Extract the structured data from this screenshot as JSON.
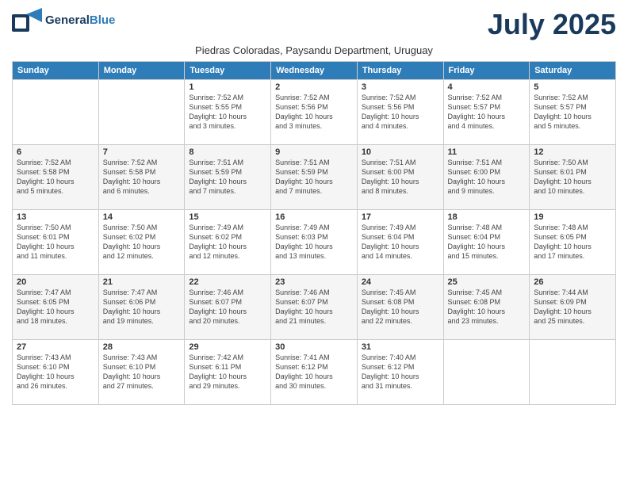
{
  "header": {
    "logo_general": "General",
    "logo_blue": "Blue",
    "month_title": "July 2025",
    "subtitle": "Piedras Coloradas, Paysandu Department, Uruguay"
  },
  "weekdays": [
    "Sunday",
    "Monday",
    "Tuesday",
    "Wednesday",
    "Thursday",
    "Friday",
    "Saturday"
  ],
  "rows": [
    [
      {
        "day": "",
        "info": ""
      },
      {
        "day": "",
        "info": ""
      },
      {
        "day": "1",
        "info": "Sunrise: 7:52 AM\nSunset: 5:55 PM\nDaylight: 10 hours\nand 3 minutes."
      },
      {
        "day": "2",
        "info": "Sunrise: 7:52 AM\nSunset: 5:56 PM\nDaylight: 10 hours\nand 3 minutes."
      },
      {
        "day": "3",
        "info": "Sunrise: 7:52 AM\nSunset: 5:56 PM\nDaylight: 10 hours\nand 4 minutes."
      },
      {
        "day": "4",
        "info": "Sunrise: 7:52 AM\nSunset: 5:57 PM\nDaylight: 10 hours\nand 4 minutes."
      },
      {
        "day": "5",
        "info": "Sunrise: 7:52 AM\nSunset: 5:57 PM\nDaylight: 10 hours\nand 5 minutes."
      }
    ],
    [
      {
        "day": "6",
        "info": "Sunrise: 7:52 AM\nSunset: 5:58 PM\nDaylight: 10 hours\nand 5 minutes."
      },
      {
        "day": "7",
        "info": "Sunrise: 7:52 AM\nSunset: 5:58 PM\nDaylight: 10 hours\nand 6 minutes."
      },
      {
        "day": "8",
        "info": "Sunrise: 7:51 AM\nSunset: 5:59 PM\nDaylight: 10 hours\nand 7 minutes."
      },
      {
        "day": "9",
        "info": "Sunrise: 7:51 AM\nSunset: 5:59 PM\nDaylight: 10 hours\nand 7 minutes."
      },
      {
        "day": "10",
        "info": "Sunrise: 7:51 AM\nSunset: 6:00 PM\nDaylight: 10 hours\nand 8 minutes."
      },
      {
        "day": "11",
        "info": "Sunrise: 7:51 AM\nSunset: 6:00 PM\nDaylight: 10 hours\nand 9 minutes."
      },
      {
        "day": "12",
        "info": "Sunrise: 7:50 AM\nSunset: 6:01 PM\nDaylight: 10 hours\nand 10 minutes."
      }
    ],
    [
      {
        "day": "13",
        "info": "Sunrise: 7:50 AM\nSunset: 6:01 PM\nDaylight: 10 hours\nand 11 minutes."
      },
      {
        "day": "14",
        "info": "Sunrise: 7:50 AM\nSunset: 6:02 PM\nDaylight: 10 hours\nand 12 minutes."
      },
      {
        "day": "15",
        "info": "Sunrise: 7:49 AM\nSunset: 6:02 PM\nDaylight: 10 hours\nand 12 minutes."
      },
      {
        "day": "16",
        "info": "Sunrise: 7:49 AM\nSunset: 6:03 PM\nDaylight: 10 hours\nand 13 minutes."
      },
      {
        "day": "17",
        "info": "Sunrise: 7:49 AM\nSunset: 6:04 PM\nDaylight: 10 hours\nand 14 minutes."
      },
      {
        "day": "18",
        "info": "Sunrise: 7:48 AM\nSunset: 6:04 PM\nDaylight: 10 hours\nand 15 minutes."
      },
      {
        "day": "19",
        "info": "Sunrise: 7:48 AM\nSunset: 6:05 PM\nDaylight: 10 hours\nand 17 minutes."
      }
    ],
    [
      {
        "day": "20",
        "info": "Sunrise: 7:47 AM\nSunset: 6:05 PM\nDaylight: 10 hours\nand 18 minutes."
      },
      {
        "day": "21",
        "info": "Sunrise: 7:47 AM\nSunset: 6:06 PM\nDaylight: 10 hours\nand 19 minutes."
      },
      {
        "day": "22",
        "info": "Sunrise: 7:46 AM\nSunset: 6:07 PM\nDaylight: 10 hours\nand 20 minutes."
      },
      {
        "day": "23",
        "info": "Sunrise: 7:46 AM\nSunset: 6:07 PM\nDaylight: 10 hours\nand 21 minutes."
      },
      {
        "day": "24",
        "info": "Sunrise: 7:45 AM\nSunset: 6:08 PM\nDaylight: 10 hours\nand 22 minutes."
      },
      {
        "day": "25",
        "info": "Sunrise: 7:45 AM\nSunset: 6:08 PM\nDaylight: 10 hours\nand 23 minutes."
      },
      {
        "day": "26",
        "info": "Sunrise: 7:44 AM\nSunset: 6:09 PM\nDaylight: 10 hours\nand 25 minutes."
      }
    ],
    [
      {
        "day": "27",
        "info": "Sunrise: 7:43 AM\nSunset: 6:10 PM\nDaylight: 10 hours\nand 26 minutes."
      },
      {
        "day": "28",
        "info": "Sunrise: 7:43 AM\nSunset: 6:10 PM\nDaylight: 10 hours\nand 27 minutes."
      },
      {
        "day": "29",
        "info": "Sunrise: 7:42 AM\nSunset: 6:11 PM\nDaylight: 10 hours\nand 29 minutes."
      },
      {
        "day": "30",
        "info": "Sunrise: 7:41 AM\nSunset: 6:12 PM\nDaylight: 10 hours\nand 30 minutes."
      },
      {
        "day": "31",
        "info": "Sunrise: 7:40 AM\nSunset: 6:12 PM\nDaylight: 10 hours\nand 31 minutes."
      },
      {
        "day": "",
        "info": ""
      },
      {
        "day": "",
        "info": ""
      }
    ]
  ]
}
